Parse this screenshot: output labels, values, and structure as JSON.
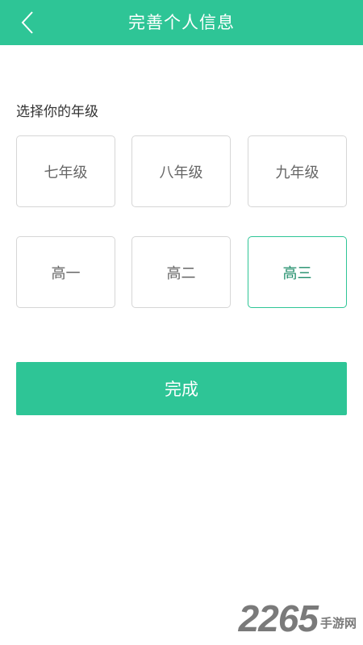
{
  "header": {
    "title": "完善个人信息",
    "back_icon": "chevron-left-icon",
    "background_color": "#2ec596"
  },
  "grade_section": {
    "label": "选择你的年级",
    "options": [
      {
        "label": "七年级",
        "selected": false
      },
      {
        "label": "八年级",
        "selected": false
      },
      {
        "label": "九年级",
        "selected": false
      },
      {
        "label": "高一",
        "selected": false
      },
      {
        "label": "高二",
        "selected": false
      },
      {
        "label": "高三",
        "selected": true
      }
    ],
    "selected_color": "#2ec596"
  },
  "complete_button": {
    "label": "完成"
  },
  "watermark": {
    "number": "2265",
    "text": "手游网"
  }
}
